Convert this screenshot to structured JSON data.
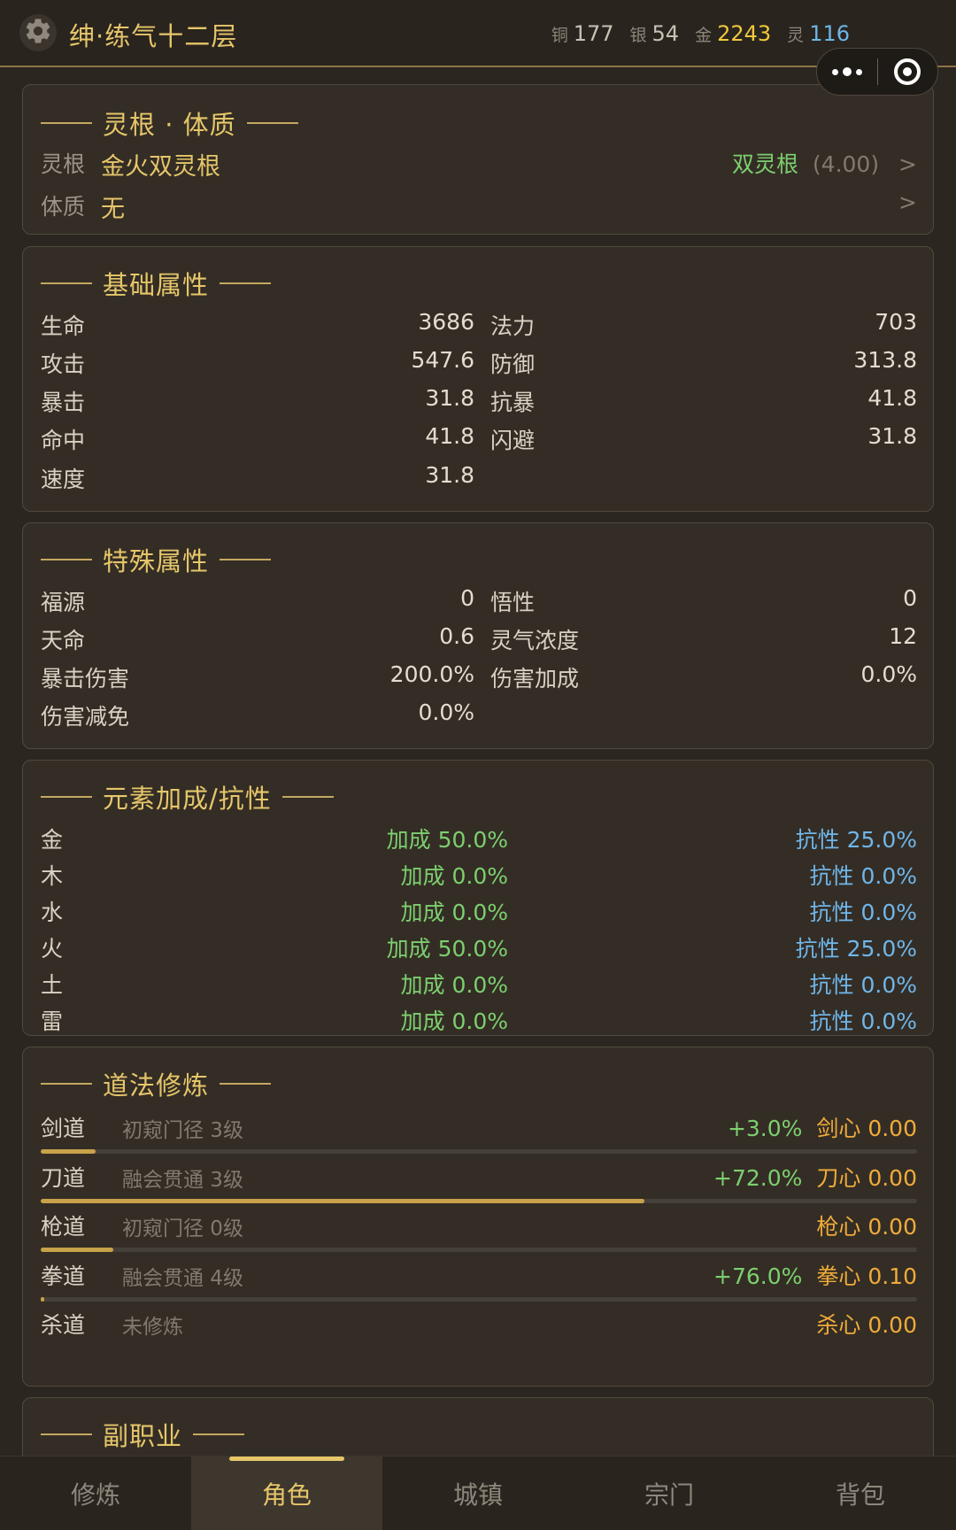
{
  "header": {
    "title": "绅·练气十二层",
    "currency": [
      {
        "label": "铜",
        "value": "177"
      },
      {
        "label": "银",
        "value": "54"
      },
      {
        "label": "金",
        "value": "2243"
      },
      {
        "label": "灵",
        "value": "116"
      }
    ]
  },
  "root": {
    "title": "灵根 · 体质",
    "lingen_label": "灵根",
    "lingen_value": "金火双灵根",
    "lingen_type": "双灵根",
    "lingen_score": "(4.00)",
    "tizhi_label": "体质",
    "tizhi_value": "无",
    "arrow": ">"
  },
  "basic": {
    "title": "基础属性",
    "rows": [
      {
        "l1": "生命",
        "v1": "3686",
        "l2": "法力",
        "v2": "703"
      },
      {
        "l1": "攻击",
        "v1": "547.6",
        "l2": "防御",
        "v2": "313.8"
      },
      {
        "l1": "暴击",
        "v1": "31.8",
        "l2": "抗暴",
        "v2": "41.8"
      },
      {
        "l1": "命中",
        "v1": "41.8",
        "l2": "闪避",
        "v2": "31.8"
      },
      {
        "l1": "速度",
        "v1": "31.8"
      }
    ]
  },
  "special": {
    "title": "特殊属性",
    "rows": [
      {
        "l1": "福源",
        "v1": "0",
        "l2": "悟性",
        "v2": "0"
      },
      {
        "l1": "天命",
        "v1": "0.6",
        "l2": "灵气浓度",
        "v2": "12"
      },
      {
        "l1": "暴击伤害",
        "v1": "200.0%",
        "l2": "伤害加成",
        "v2": "0.0%"
      },
      {
        "l1": "伤害减免",
        "v1": "0.0%"
      }
    ]
  },
  "element": {
    "title": "元素加成/抗性",
    "rows": [
      {
        "name": "金",
        "bonus": "加成 50.0%",
        "resist": "抗性 25.0%"
      },
      {
        "name": "木",
        "bonus": "加成 0.0%",
        "resist": "抗性 0.0%"
      },
      {
        "name": "水",
        "bonus": "加成 0.0%",
        "resist": "抗性 0.0%"
      },
      {
        "name": "火",
        "bonus": "加成 50.0%",
        "resist": "抗性 25.0%"
      },
      {
        "name": "土",
        "bonus": "加成 0.0%",
        "resist": "抗性 0.0%"
      },
      {
        "name": "雷",
        "bonus": "加成 0.0%",
        "resist": "抗性 0.0%"
      }
    ]
  },
  "dao": {
    "title": "道法修炼",
    "rows": [
      {
        "name": "剑道",
        "stage": "初窥门径 3级",
        "bonus": "+3.0%",
        "heart": "剑心 0.00",
        "progress": 0.063
      },
      {
        "name": "刀道",
        "stage": "融会贯通 3级",
        "bonus": "+72.0%",
        "heart": "刀心 0.00",
        "progress": 0.689
      },
      {
        "name": "枪道",
        "stage": "初窥门径 0级",
        "bonus": "",
        "heart": "枪心 0.00",
        "progress": 0.083
      },
      {
        "name": "拳道",
        "stage": "融会贯通 4级",
        "bonus": "+76.0%",
        "heart": "拳心 0.10",
        "progress": 0.004
      },
      {
        "name": "杀道",
        "stage": "未修炼",
        "bonus": "",
        "heart": "杀心 0.00"
      }
    ]
  },
  "sub": {
    "title": "副职业"
  },
  "nav": [
    "修炼",
    "角色",
    "城镇",
    "宗门",
    "背包"
  ]
}
